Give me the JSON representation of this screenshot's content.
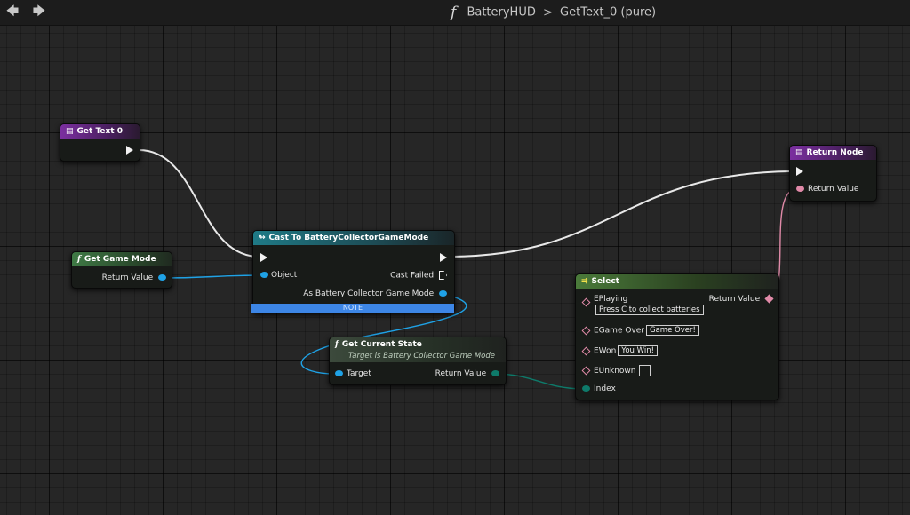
{
  "nav": {
    "back_icon": "arrow-left-icon",
    "forward_icon": "arrow-right-icon"
  },
  "breadcrumb": {
    "function_icon": "f",
    "graph": "BatteryHUD",
    "separator": ">",
    "function": "GetText_0 (pure)"
  },
  "nodes": {
    "get_text": {
      "title": "Get Text 0",
      "icon": "function-entry-icon"
    },
    "get_game_mode": {
      "icon": "f",
      "title": "Get Game Mode",
      "pin_return": "Return Value"
    },
    "cast": {
      "icon": "cast-icon",
      "title": "Cast To BatteryCollectorGameMode",
      "pin_object": "Object",
      "pin_cast_failed": "Cast Failed",
      "pin_as": "As Battery Collector Game Mode",
      "note": "NOTE"
    },
    "get_current_state": {
      "icon": "f",
      "title": "Get Current State",
      "subtitle": "Target is Battery Collector Game Mode",
      "pin_target": "Target",
      "pin_return": "Return Value"
    },
    "select": {
      "icon": "select-icon",
      "title": "Select",
      "return_value": "Return Value",
      "options": [
        {
          "label": "EPlaying",
          "value": "Press C to collect batteries"
        },
        {
          "label": "EGame Over",
          "value": "Game Over!"
        },
        {
          "label": "EWon",
          "value": "You Win!"
        },
        {
          "label": "EUnknown",
          "value": ""
        }
      ],
      "index": "Index"
    },
    "return_node": {
      "title": "Return Node",
      "icon": "function-result-icon",
      "pin_return": "Return Value"
    }
  },
  "colors": {
    "exec": "#f2f2f2",
    "object_pin": "#1fa2e6",
    "byte_pin": "#0e7a6a",
    "text_pin": "#e08aa8",
    "note": "#3d86e6"
  }
}
